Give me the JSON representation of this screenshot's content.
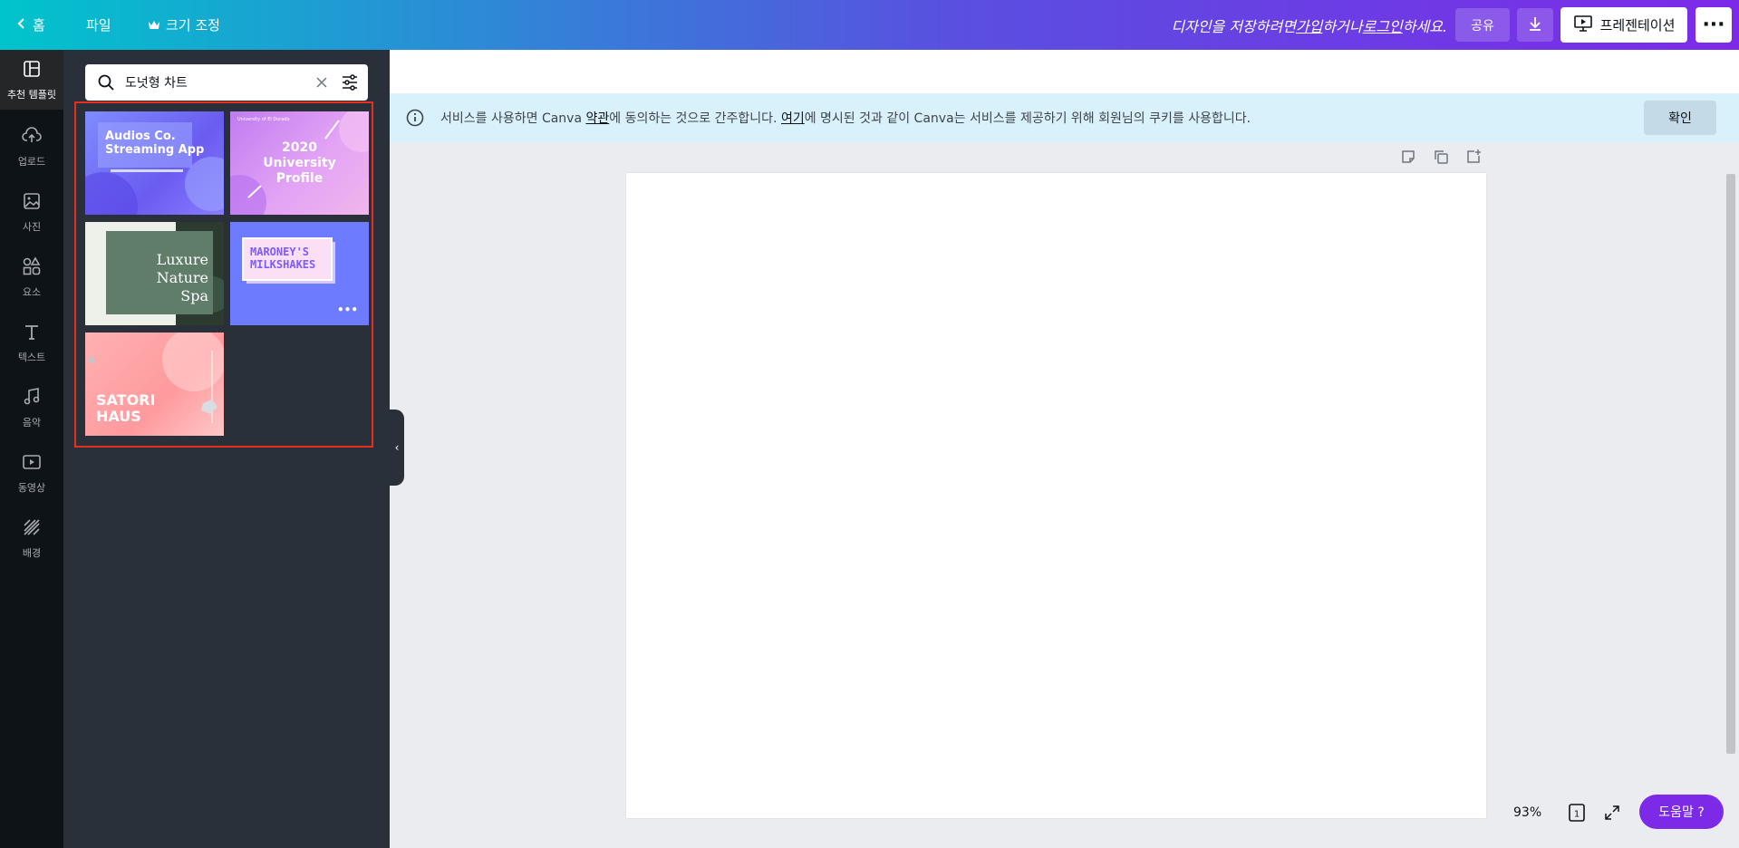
{
  "topbar": {
    "home_label": "홈",
    "file_label": "파일",
    "resize_label": "크기 조정",
    "message": {
      "part1": "디자인을 저장하려면 ",
      "signup": "가입",
      "part2": "하거나 ",
      "login": "로그인",
      "part3": "하세요."
    },
    "share_label": "공유",
    "present_label": "프레젠테이션",
    "more_label": "···"
  },
  "rail": {
    "items": [
      {
        "label": "추천 템플릿",
        "icon": "template-icon"
      },
      {
        "label": "업로드",
        "icon": "upload-cloud-icon"
      },
      {
        "label": "사진",
        "icon": "photo-icon"
      },
      {
        "label": "요소",
        "icon": "elements-icon"
      },
      {
        "label": "텍스트",
        "icon": "text-icon"
      },
      {
        "label": "음악",
        "icon": "music-icon"
      },
      {
        "label": "동영상",
        "icon": "video-icon"
      },
      {
        "label": "배경",
        "icon": "background-icon"
      }
    ]
  },
  "panel": {
    "search_value": "도넛형 차트",
    "templates": [
      {
        "title_line1": "Audios Co.",
        "title_line2": "Streaming App"
      },
      {
        "small": "University of El Dorado",
        "title_line1": "2020",
        "title_line2": "University",
        "title_line3": "Profile"
      },
      {
        "title_line1": "Luxure",
        "title_line2": "Nature Spa"
      },
      {
        "title_line1": "MARONEY'S",
        "title_line2": "MILKSHAKES"
      },
      {
        "title_line1": "SATORI",
        "title_line2": "HAUS"
      }
    ]
  },
  "notice": {
    "text1": "서비스를 사용하면 Canva ",
    "terms": "약관",
    "text2": "에 동의하는 것으로 간주합니다. ",
    "here": "여기",
    "text3": "에 명시된 것과 같이 Canva는 서비스를 제공하기 위해 회원님의 쿠키를 사용합니다.",
    "ok_label": "확인"
  },
  "footer": {
    "zoom": "93%",
    "page_count": "1",
    "help_label": "도움말 ?"
  },
  "colors": {
    "accent": "#7d2ae8",
    "gradient_start": "#00c4cc",
    "highlight_border": "#e3301f"
  }
}
